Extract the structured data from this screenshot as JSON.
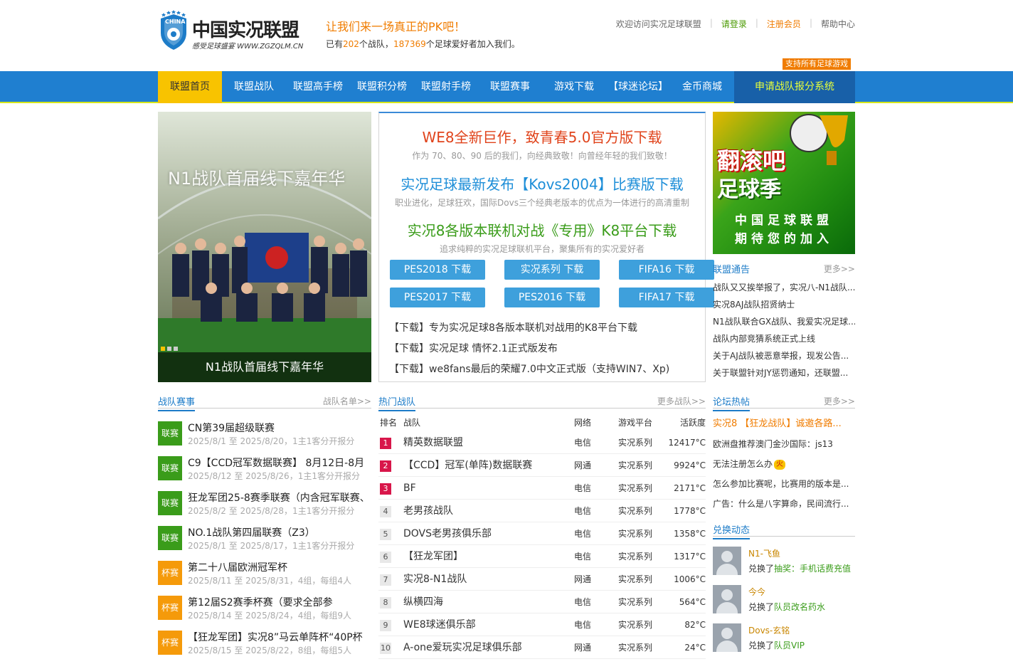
{
  "header": {
    "brand": "中国实况联盟",
    "brand_sub": "感受足球盛宴 WWW.ZGZQLM.CN",
    "badge_text": "CHINA",
    "slogan": "让我们来一场真正的PK吧！",
    "stats_prefix": "已有",
    "team_count": "202",
    "stats_mid": "个战队，",
    "member_count": "187369",
    "stats_suffix": "个足球爱好者加入我们。",
    "welcome": "欢迎访问实况足球联盟",
    "login": "请登录",
    "register": "注册会员",
    "help": "帮助中心",
    "support_tag": "支持所有足球游戏"
  },
  "nav": [
    {
      "label": "联盟首页",
      "active": true
    },
    {
      "label": "联盟战队"
    },
    {
      "label": "联盟高手榜"
    },
    {
      "label": "联盟积分榜"
    },
    {
      "label": "联盟射手榜"
    },
    {
      "label": "联盟赛事"
    },
    {
      "label": "游戏下载"
    },
    {
      "label": "【球迷论坛】"
    },
    {
      "label": "金币商城"
    },
    {
      "label": "申请战队报分系统",
      "apply": true
    }
  ],
  "slider": {
    "big_title": "N1战队首届线下嘉年华",
    "caption": "N1战队首届线下嘉年华"
  },
  "features": [
    {
      "title": "WE8全新巨作，致青春5.0官方版下载",
      "desc": "作为 70、80、90 后的我们，向经典致敬！向曾经年轻的我们致敬！"
    },
    {
      "title": "实况足球最新发布【Kovs2004】比赛版下载",
      "desc": "职业进化，足球狂欢，国际Dovs三个经典老版本的优点为一体进行的高清重制"
    },
    {
      "title": "实况8各版本联机对战《专用》K8平台下载",
      "desc": "追求纯粹的实况足球联机平台，聚集所有的实况爱好者"
    }
  ],
  "download_buttons": [
    "PES2018 下载",
    "实况系列 下载",
    "FIFA16 下载",
    "PES2017 下载",
    "PES2016 下载",
    "FIFA17 下载"
  ],
  "download_links": [
    "【下载】专为实况足球8各版本联机对战用的K8平台下载",
    "【下载】实况足球 情怀2.1正式版发布",
    "【下载】we8fans最后的荣耀7.0中文正式版（支持WIN7、Xp)"
  ],
  "ad": {
    "line1": "翻滚吧",
    "line2": "足球季",
    "line3": "中国足球联盟",
    "line4": "期待您的加入"
  },
  "notice": {
    "title": "联盟通告",
    "more": "更多>>",
    "items": [
      "战队又又挨举报了，实况八-N1战队...",
      "实况8AJ战队招贤纳士",
      "N1战队联合GX战队、我爱实况足球...",
      "战队内部竞猜系统正式上线",
      "关于AJ战队被恶意举报，现发公告...",
      "关于联盟针对JY惩罚通知，还联盟..."
    ]
  },
  "events": {
    "title": "战队赛事",
    "more": "战队名单>>",
    "items": [
      {
        "tag": "联赛",
        "type": "league",
        "title": "CN第39届超级联赛",
        "desc": "2025/8/1 至 2025/8/20，1主1客分开报分"
      },
      {
        "tag": "联赛",
        "type": "league",
        "title": "C9【CCD冠军数据联赛】 8月12日-8月",
        "desc": "2025/8/12 至 2025/8/26，1主1客分开报分"
      },
      {
        "tag": "联赛",
        "type": "league",
        "title": "狂龙军团25-8赛季联赛（内含冠军联赛、",
        "desc": "2025/8/2 至 2025/8/28，1主1客分开报分"
      },
      {
        "tag": "联赛",
        "type": "league",
        "title": "NO.1战队第四届联赛（Z3）",
        "desc": "2025/8/1 至 2025/8/17，1主1客分开报分"
      },
      {
        "tag": "杯赛",
        "type": "cup",
        "title": "第二十八届欧洲冠军杯",
        "desc": "2025/8/11 至 2025/8/31，4组，每组4人"
      },
      {
        "tag": "杯赛",
        "type": "cup",
        "title": "第12届S2赛季杯赛（要求全部参",
        "desc": "2025/8/14 至 2025/8/24，4组，每组9人"
      },
      {
        "tag": "杯赛",
        "type": "cup",
        "title": "【狂龙军团】实况8”马云单阵杯“40P杯",
        "desc": "2025/8/15 至 2025/8/22，8组，每组5人"
      }
    ]
  },
  "teams": {
    "title": "热门战队",
    "more": "更多战队>>",
    "headers": [
      "排名",
      "战队",
      "网络",
      "游戏平台",
      "活跃度"
    ],
    "rows": [
      {
        "rank": "1",
        "name": "精英数据联盟",
        "net": "电信",
        "platform": "实况系列",
        "activity": "12417°C"
      },
      {
        "rank": "2",
        "name": "【CCD】冠军(单阵)数据联赛",
        "net": "网通",
        "platform": "实况系列",
        "activity": "9924°C"
      },
      {
        "rank": "3",
        "name": "BF",
        "net": "电信",
        "platform": "实况系列",
        "activity": "2171°C"
      },
      {
        "rank": "4",
        "name": "老男孩战队",
        "net": "电信",
        "platform": "实况系列",
        "activity": "1778°C"
      },
      {
        "rank": "5",
        "name": "DOVS老男孩俱乐部",
        "net": "电信",
        "platform": "实况系列",
        "activity": "1358°C"
      },
      {
        "rank": "6",
        "name": "【狂龙军团】",
        "net": "电信",
        "platform": "实况系列",
        "activity": "1317°C"
      },
      {
        "rank": "7",
        "name": "实况8-N1战队",
        "net": "网通",
        "platform": "实况系列",
        "activity": "1006°C"
      },
      {
        "rank": "8",
        "name": "纵横四海",
        "net": "电信",
        "platform": "实况系列",
        "activity": "564°C"
      },
      {
        "rank": "9",
        "name": "WE8球迷俱乐部",
        "net": "电信",
        "platform": "实况系列",
        "activity": "82°C"
      },
      {
        "rank": "10",
        "name": "A-one爱玩实况足球俱乐部",
        "net": "网通",
        "platform": "实况系列",
        "activity": "24°C"
      }
    ]
  },
  "forum": {
    "title": "论坛热帖",
    "more": "更多>>",
    "items": [
      "实况8 【狂龙战队】诚邀各路...",
      "欧洲盘推荐澳门金沙国际：js13",
      "无法注册怎么办",
      "怎么参加比赛呢，比赛用的版本是...",
      "广告：什么是八字算命，民间流行..."
    ],
    "hot_label": "火"
  },
  "exchange": {
    "title": "兑换动态",
    "items": [
      {
        "name": "N1-飞鱼",
        "action": "兑换了",
        "item": "抽奖：手机话费充值"
      },
      {
        "name": "今今",
        "action": "兑换了",
        "item": "队员改名药水"
      },
      {
        "name": "Dovs-玄铭",
        "action": "兑换了",
        "item": "队员VIP"
      }
    ]
  }
}
